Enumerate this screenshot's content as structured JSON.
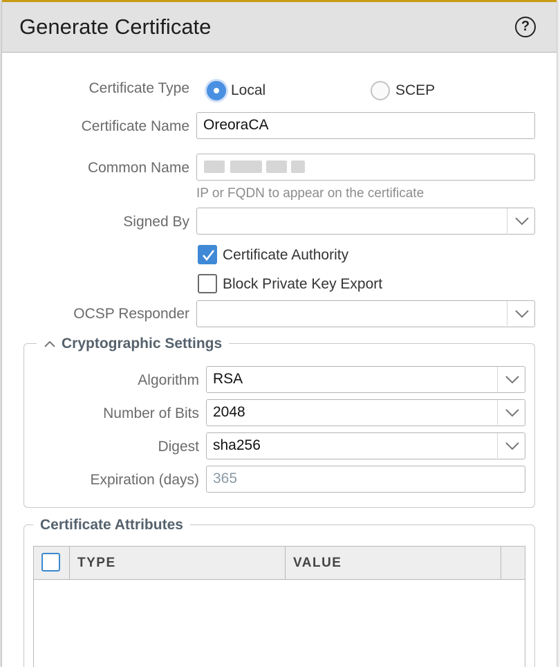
{
  "dialog": {
    "title": "Generate Certificate",
    "help_icon_glyph": "?"
  },
  "form": {
    "certificate_type": {
      "label": "Certificate Type",
      "options": [
        {
          "label": "Local",
          "selected": true
        },
        {
          "label": "SCEP",
          "selected": false
        }
      ]
    },
    "certificate_name": {
      "label": "Certificate Name",
      "value": "OreoraCA"
    },
    "common_name": {
      "label": "Common Name",
      "value": "",
      "hint": "IP or FQDN to appear on the certificate"
    },
    "signed_by": {
      "label": "Signed By",
      "value": ""
    },
    "certificate_authority": {
      "label": "Certificate Authority",
      "checked": true
    },
    "block_private_key_export": {
      "label": "Block Private Key Export",
      "checked": false
    },
    "ocsp_responder": {
      "label": "OCSP Responder",
      "value": ""
    }
  },
  "crypto": {
    "legend": "Cryptographic Settings",
    "algorithm": {
      "label": "Algorithm",
      "value": "RSA"
    },
    "number_of_bits": {
      "label": "Number of Bits",
      "value": "2048"
    },
    "digest": {
      "label": "Digest",
      "value": "sha256"
    },
    "expiration": {
      "label": "Expiration (days)",
      "value": "365"
    }
  },
  "attributes": {
    "legend": "Certificate Attributes",
    "columns": [
      "TYPE",
      "VALUE"
    ],
    "rows": []
  },
  "colors": {
    "accent": "#4a90e2",
    "checkbox_on": "#3f89d6",
    "title_bar": "#e2e2e2",
    "label_text": "#6b6b6b",
    "legend_text": "#55626d"
  }
}
